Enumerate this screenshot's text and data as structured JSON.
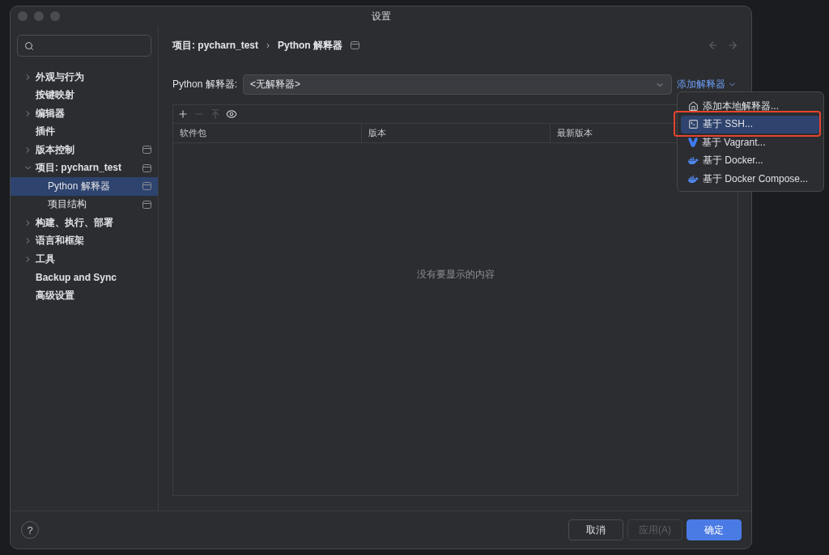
{
  "window": {
    "title": "设置"
  },
  "sidebar": {
    "items": [
      {
        "label": "外观与行为",
        "expanded": false,
        "selected": false,
        "project_scope": false
      },
      {
        "label": "按键映射",
        "selected": false,
        "project_scope": false
      },
      {
        "label": "编辑器",
        "expanded": false,
        "selected": false,
        "project_scope": false
      },
      {
        "label": "插件",
        "selected": false,
        "project_scope": false
      },
      {
        "label": "版本控制",
        "expanded": false,
        "selected": false,
        "project_scope": true
      },
      {
        "label": "项目: pycharn_test",
        "expanded": true,
        "selected": false,
        "project_scope": true,
        "children": [
          {
            "label": "Python 解释器",
            "selected": true,
            "project_scope": true
          },
          {
            "label": "项目结构",
            "selected": false,
            "project_scope": true
          }
        ]
      },
      {
        "label": "构建、执行、部署",
        "expanded": false,
        "selected": false,
        "project_scope": false
      },
      {
        "label": "语言和框架",
        "expanded": false,
        "selected": false,
        "project_scope": false
      },
      {
        "label": "工具",
        "expanded": false,
        "selected": false,
        "project_scope": false
      },
      {
        "label": "Backup and Sync",
        "selected": false,
        "project_scope": false
      },
      {
        "label": "高级设置",
        "selected": false,
        "project_scope": false
      }
    ]
  },
  "breadcrumb": {
    "items": [
      "项目: pycharn_test",
      "Python 解释器"
    ],
    "separator": "›",
    "project_scope": true
  },
  "interpreter": {
    "label": "Python 解释器:",
    "value": "<无解释器>",
    "add_link": "添加解释器"
  },
  "packages": {
    "toolbar": [
      {
        "kind": "add",
        "disabled": false
      },
      {
        "kind": "remove",
        "disabled": true
      },
      {
        "kind": "upgrade",
        "disabled": true
      },
      {
        "kind": "show",
        "disabled": false
      }
    ],
    "columns": [
      "软件包",
      "版本",
      "最新版本"
    ],
    "empty_text": "没有要显示的内容"
  },
  "add_menu": {
    "items": [
      {
        "kind": "local",
        "label": "添加本地解释器...",
        "selected": false,
        "annotated": false
      },
      {
        "kind": "ssh",
        "label": "基于 SSH...",
        "selected": true,
        "annotated": true
      },
      {
        "kind": "vagrant",
        "label": "基于 Vagrant...",
        "selected": false,
        "annotated": false
      },
      {
        "kind": "docker",
        "label": "基于 Docker...",
        "selected": false,
        "annotated": false
      },
      {
        "kind": "compose",
        "label": "基于 Docker Compose...",
        "selected": false,
        "annotated": false
      }
    ]
  },
  "help": "?",
  "buttons": [
    {
      "label": "取消",
      "kind": "default",
      "disabled": false
    },
    {
      "label": "应用(A)",
      "kind": "default",
      "disabled": true
    },
    {
      "label": "确定",
      "kind": "primary",
      "disabled": false
    }
  ]
}
